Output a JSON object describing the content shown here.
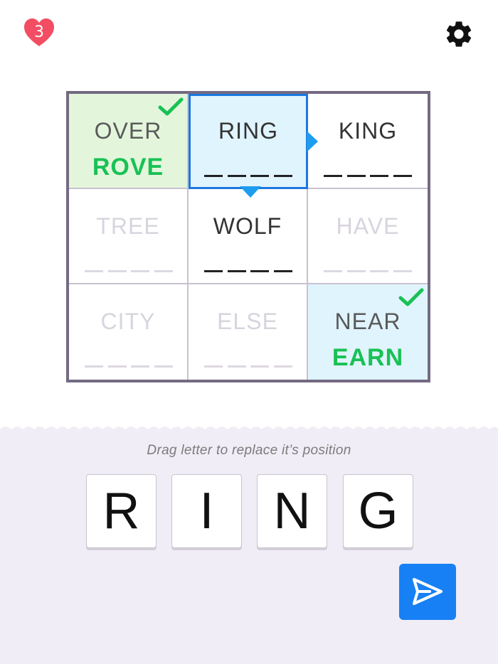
{
  "lives": {
    "count": "3",
    "icon": "heart-icon",
    "color": "#f24d63"
  },
  "settings": {
    "icon": "gear-icon"
  },
  "board": {
    "cells": [
      {
        "word": "OVER",
        "answer": "ROVE",
        "state": "solved"
      },
      {
        "word": "RING",
        "answer": "",
        "state": "active"
      },
      {
        "word": "KING",
        "answer": "",
        "state": "open"
      },
      {
        "word": "TREE",
        "answer": "",
        "state": "locked"
      },
      {
        "word": "WOLF",
        "answer": "",
        "state": "open"
      },
      {
        "word": "HAVE",
        "answer": "",
        "state": "locked"
      },
      {
        "word": "CITY",
        "answer": "",
        "state": "locked"
      },
      {
        "word": "ELSE",
        "answer": "",
        "state": "locked"
      },
      {
        "word": "NEAR",
        "answer": "EARN",
        "state": "solved"
      }
    ]
  },
  "tray": {
    "hint": "Drag letter to replace it’s position",
    "tiles": [
      "R",
      "I",
      "N",
      "G"
    ]
  },
  "submit": {
    "icon": "send-icon",
    "color": "#1780f5"
  },
  "colors": {
    "active_border": "#1a78e0",
    "success_green": "#19c155",
    "board_border": "#746a82"
  }
}
